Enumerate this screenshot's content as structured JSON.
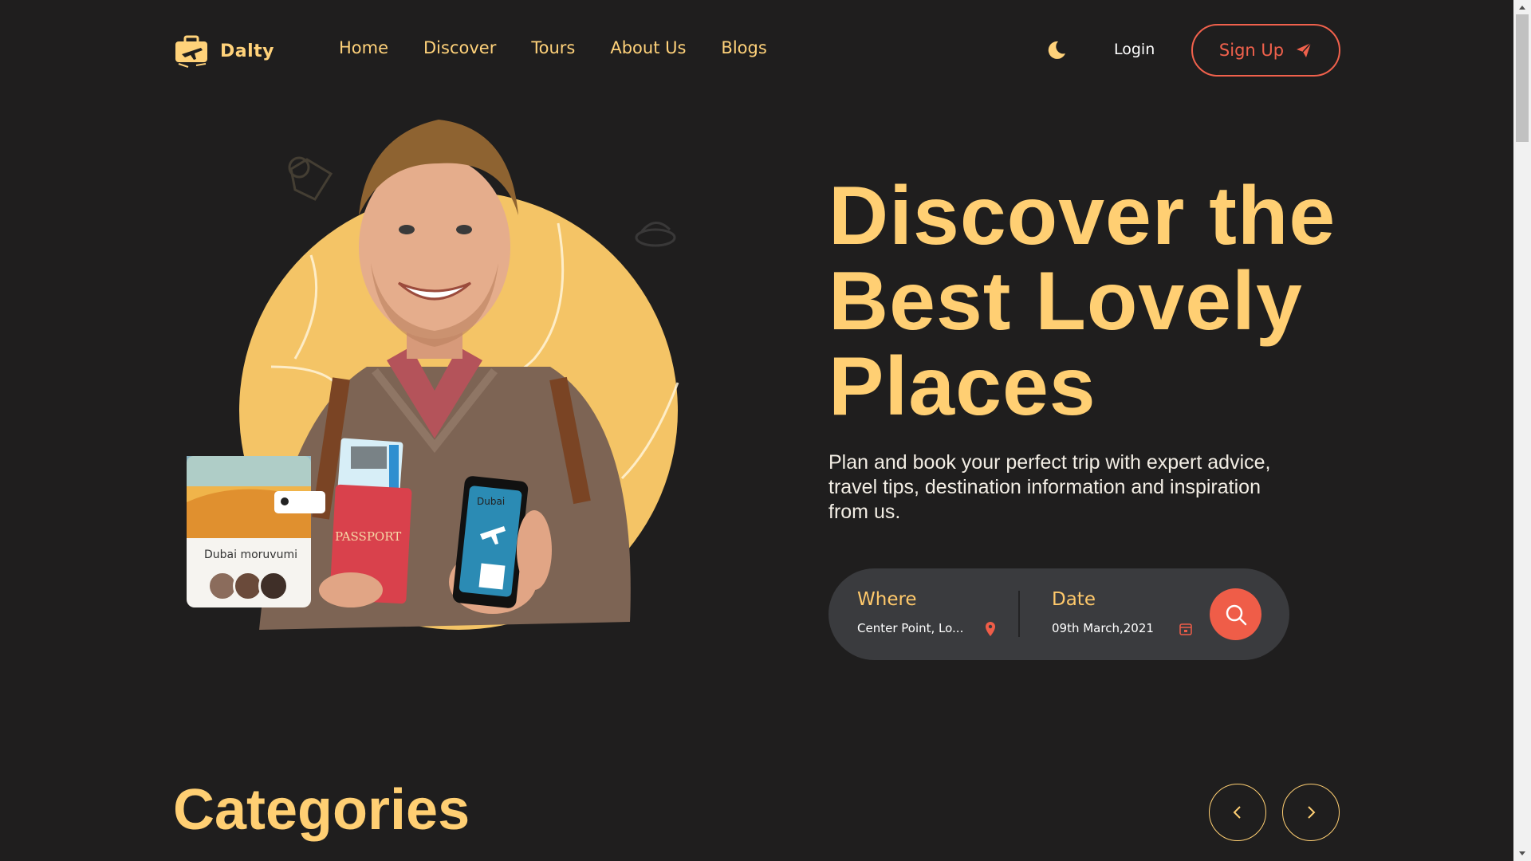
{
  "brand": {
    "name": "Dalty",
    "logo_icon": "suitcase-plane-icon"
  },
  "nav": {
    "items": [
      {
        "label": "Home"
      },
      {
        "label": "Discover"
      },
      {
        "label": "Tours"
      },
      {
        "label": "About Us"
      },
      {
        "label": "Blogs"
      }
    ]
  },
  "header": {
    "theme_toggle_icon": "moon-icon",
    "login_label": "Login",
    "signup_label": "Sign Up",
    "signup_icon": "paper-plane-icon"
  },
  "hero": {
    "headline_lines": [
      "Discover the",
      "Best Lovely",
      "Places"
    ],
    "subtitle": "Plan and book your perfect trip with expert advice, travel tips, destination information and inspiration from us.",
    "card": {
      "location_tag": "Dubai",
      "title": "Dubai moruvumi"
    },
    "passport_text": "PASSPORT"
  },
  "search": {
    "where_label": "Where",
    "where_value": "Center Point, Lo...",
    "date_label": "Date",
    "date_value": "09th March,2021",
    "button_icon": "search-icon"
  },
  "categories": {
    "title": "Categories",
    "prev_icon": "chevron-left-icon",
    "next_icon": "chevron-right-icon"
  },
  "colors": {
    "background": "#1f1e1e",
    "accent_yellow": "#ffcf73",
    "accent_coral": "#ef5d48",
    "search_bg": "#3a3b3e"
  }
}
